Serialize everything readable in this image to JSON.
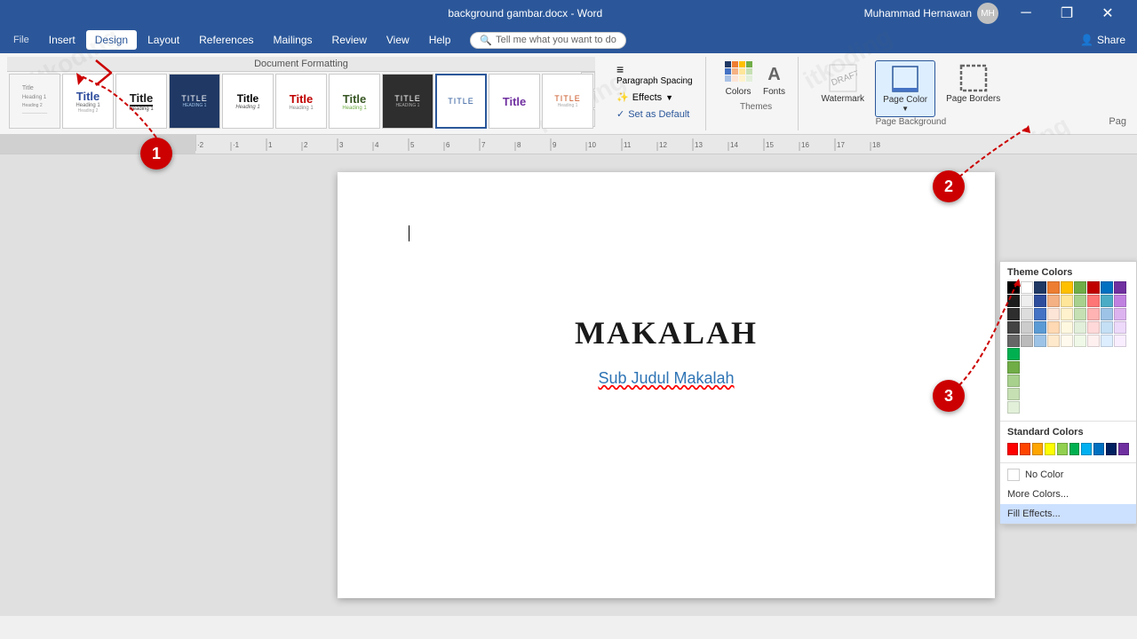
{
  "titlebar": {
    "title": "background gambar.docx - Word",
    "minimize": "─",
    "restore": "❐",
    "close": "✕",
    "user": "Muhammad Hernawan"
  },
  "menubar": {
    "items": [
      "Insert",
      "Design",
      "Layout",
      "References",
      "Mailings",
      "Review",
      "View",
      "Help"
    ],
    "active": "Design",
    "tell_me": "Tell me what you want to do",
    "share": "Share"
  },
  "ribbon": {
    "doc_format_label": "Document Formatting",
    "styles": [
      {
        "label": ""
      },
      {
        "label": "Title"
      },
      {
        "label": "Title"
      },
      {
        "label": "TITLE"
      },
      {
        "label": "Title"
      },
      {
        "label": "Title"
      },
      {
        "label": "Title"
      },
      {
        "label": "TITLE"
      },
      {
        "label": "TITLE"
      },
      {
        "label": "Title"
      },
      {
        "label": "TITLE"
      }
    ],
    "paragraph_spacing": "Paragraph Spacing",
    "effects": "Effects",
    "set_as_default": "Set as Default",
    "colors_label": "Colors",
    "fonts_label": "Fonts",
    "watermark_label": "Watermark",
    "page_color_label": "Page Color",
    "page_borders_label": "Page Borders"
  },
  "dropdown": {
    "theme_colors_title": "Theme Colors",
    "standard_colors_title": "Standard Colors",
    "no_color_label": "No Color",
    "more_colors_label": "More Colors...",
    "fill_effects_label": "Fill Effects...",
    "theme_cols": [
      [
        "#000000",
        "#1c1c1c",
        "#2e2e2e",
        "#444",
        "#555",
        "#777",
        "#999",
        "#bbb",
        "#ddd",
        "#fff"
      ],
      [
        "#1f3864",
        "#2e4d9c",
        "#4472c4",
        "#5b9bd5",
        "#9dc3e6",
        "#bdd7ee",
        "#dbe5f1",
        "#f0f6ff",
        "#e9eef7",
        "#d6e4f0"
      ],
      [
        "#7f3f00",
        "#984c00",
        "#b45900",
        "#ed7d31",
        "#f4b183",
        "#f7caac",
        "#fce4d6",
        "#fff2cc",
        "#fef4d9",
        "#fffaed"
      ],
      [
        "#375623",
        "#4e7233",
        "#538135",
        "#70ad47",
        "#a9d18e",
        "#c6e0b4",
        "#e2efda",
        "#f4ffe0",
        "#ecf7e6",
        "#d8f0c8"
      ],
      [
        "#7b0000",
        "#942121",
        "#c00000",
        "#ff0000",
        "#ff7676",
        "#ffb3b3",
        "#ffd9d9",
        "#fff0f0",
        "#ffe6e6",
        "#ffd6d6"
      ],
      [
        "#1f3d5c",
        "#264f77",
        "#2f6496",
        "#0070c0",
        "#4bacc6",
        "#9dc3e6",
        "#c5e0f5",
        "#ddeeff",
        "#e8f4ff",
        "#f0f8ff"
      ],
      [
        "#4c1130",
        "#702060",
        "#7030a0",
        "#a040c0",
        "#c080e0",
        "#ddb3ef",
        "#edd9fa",
        "#f8eeff",
        "#f4e8ff",
        "#eeddff"
      ],
      [
        "#0d2b0d",
        "#1a4d1a",
        "#1e6823",
        "#00b050",
        "#70ad47",
        "#a9d18e",
        "#c6e0b4",
        "#e2f0d9",
        "#ecf7e5",
        "#d6edca"
      ],
      [
        "#1c1c5c",
        "#2e2e7a",
        "#3f3f99",
        "#7070c0",
        "#9999d9",
        "#bbbbee",
        "#d5d5f7",
        "#e8e8ff",
        "#f0f0ff",
        "#f8f8ff"
      ],
      [
        "#4d2600",
        "#7b3f00",
        "#a05000",
        "#c06000",
        "#e08000",
        "#f0a040",
        "#f7c878",
        "#fde9be",
        "#fff4e0",
        "#fffaed"
      ]
    ],
    "std_colors": [
      "#ff0000",
      "#ff4500",
      "#ffa500",
      "#ffff00",
      "#92d050",
      "#00b050",
      "#00b0f0",
      "#0070c0",
      "#002060",
      "#7030a0"
    ],
    "fill_effects_active": true
  },
  "document": {
    "title": "MAKALAH",
    "subtitle": "Sub Judul Makalah"
  },
  "annotations": {
    "one": "1",
    "two": "2",
    "three": "3"
  },
  "page_label": "Pag"
}
